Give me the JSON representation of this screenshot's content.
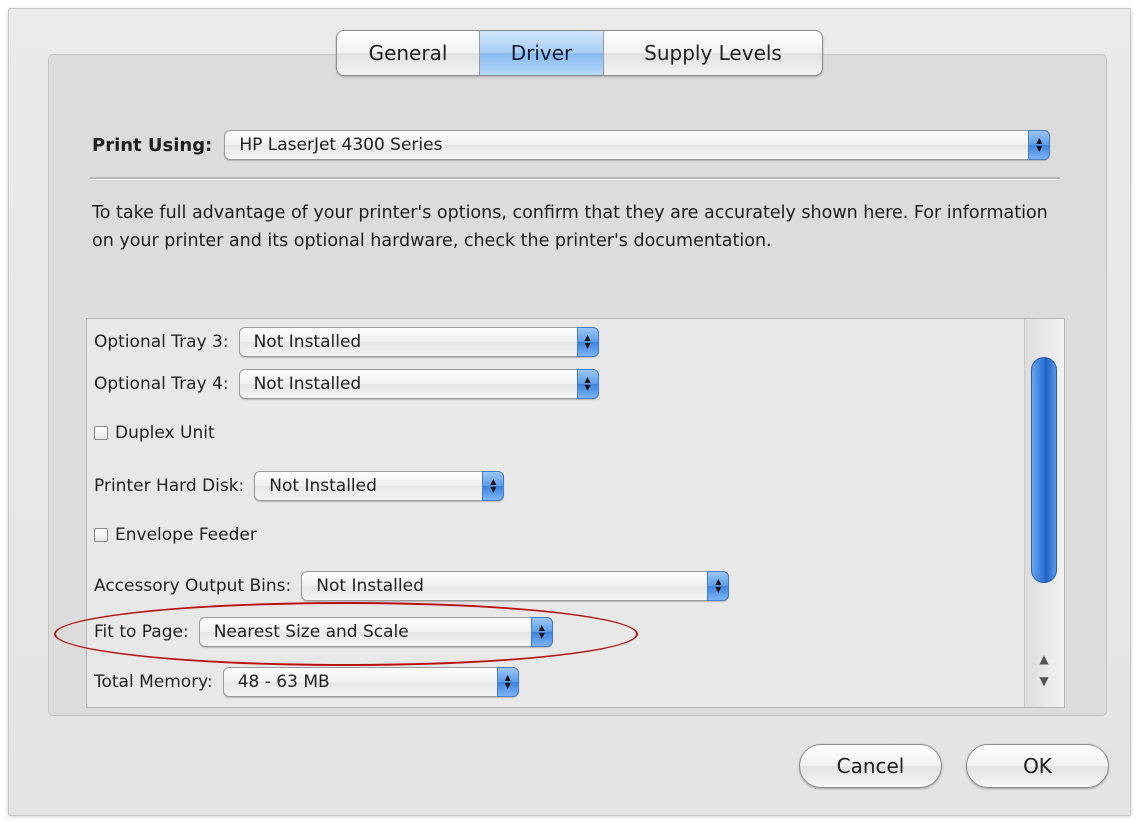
{
  "tabs": [
    {
      "label": "General",
      "active": false
    },
    {
      "label": "Driver",
      "active": true
    },
    {
      "label": "Supply Levels",
      "active": false
    }
  ],
  "print_using": {
    "label": "Print Using:",
    "value": "HP LaserJet 4300 Series"
  },
  "info_text": "To take full advantage of your printer's options, confirm that they are accurately shown here. For information on your printer and its optional hardware, check the printer's documentation.",
  "options": {
    "tray3": {
      "label": "Optional Tray 3:",
      "value": "Not Installed"
    },
    "tray4": {
      "label": "Optional Tray 4:",
      "value": "Not Installed"
    },
    "duplex": {
      "label": "Duplex Unit",
      "checked": false
    },
    "hard_disk": {
      "label": "Printer Hard Disk:",
      "value": "Not Installed"
    },
    "envelope": {
      "label": "Envelope Feeder",
      "checked": false
    },
    "output_bins": {
      "label": "Accessory Output Bins:",
      "value": "Not Installed"
    },
    "fit_to_page": {
      "label": "Fit to Page:",
      "value": "Nearest Size and Scale"
    },
    "memory": {
      "label": "Total Memory:",
      "value": "48 - 63 MB"
    }
  },
  "buttons": {
    "cancel": "Cancel",
    "ok": "OK"
  },
  "colors": {
    "accent": "#3b82e0",
    "highlight_oval": "#b81010"
  }
}
